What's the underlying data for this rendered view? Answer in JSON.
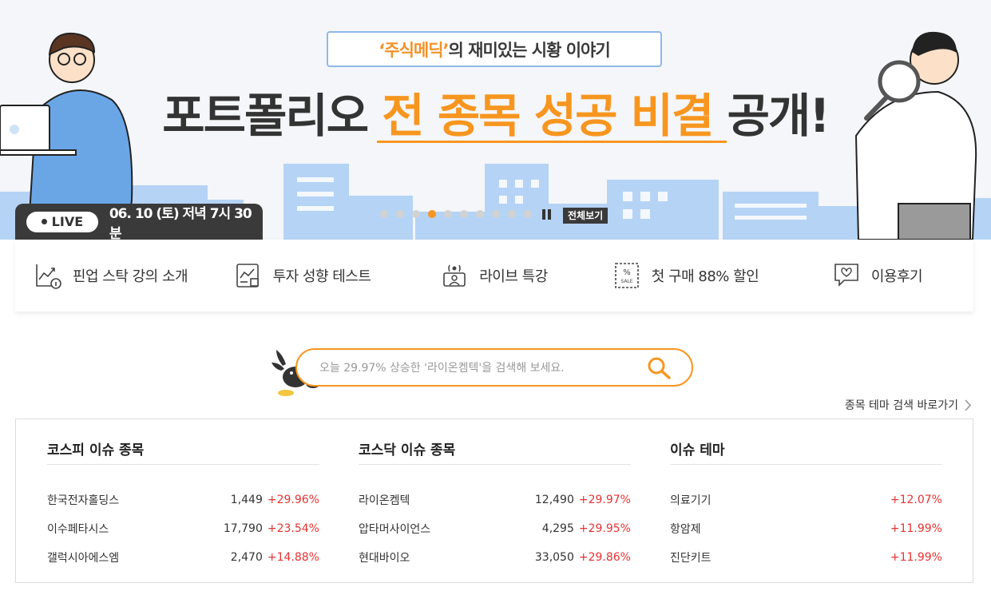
{
  "banner": {
    "subtitle_highlight": "‘주식메딕’",
    "subtitle_rest": "의 재미있는 시황 이야기",
    "headline_pre": "포트폴리오",
    "headline_highlight": "전 종목 성공 비결",
    "headline_post": "공개!",
    "live_label": "LIVE",
    "live_datetime": "06. 10 (토) 저녁 7시 30분",
    "slide_count": 10,
    "active_slide": 4,
    "view_all_label": "전체보기",
    "accent_color": "#f7961f"
  },
  "menu": [
    {
      "label": "핀업 스탁 강의 소개",
      "icon": "chart-info-icon"
    },
    {
      "label": "투자 성향 테스트",
      "icon": "test-chart-icon"
    },
    {
      "label": "라이브 특강",
      "icon": "live-broadcast-icon"
    },
    {
      "label": "첫 구매 88% 할인",
      "icon": "sale-tag-icon"
    },
    {
      "label": "이용후기",
      "icon": "review-chat-icon"
    }
  ],
  "search": {
    "placeholder": "오늘 29.97% 상승한 '라이온켐텍'을 검색해 보세요."
  },
  "theme_link": "종목 테마 검색 바로가기",
  "panels": {
    "kospi": {
      "title": "코스피 이슈 종목",
      "rows": [
        {
          "name": "한국전자홀딩스",
          "price": "1,449",
          "change": "+29.96%"
        },
        {
          "name": "이수페타시스",
          "price": "17,790",
          "change": "+23.54%"
        },
        {
          "name": "갤럭시아에스엠",
          "price": "2,470",
          "change": "+14.88%"
        }
      ]
    },
    "kosdaq": {
      "title": "코스닥 이슈 종목",
      "rows": [
        {
          "name": "라이온켐텍",
          "price": "12,490",
          "change": "+29.97%"
        },
        {
          "name": "압타머사이언스",
          "price": "4,295",
          "change": "+29.95%"
        },
        {
          "name": "현대바이오",
          "price": "33,050",
          "change": "+29.86%"
        }
      ]
    },
    "theme": {
      "title": "이슈 테마",
      "rows": [
        {
          "name": "의료기기",
          "change": "+12.07%"
        },
        {
          "name": "항암제",
          "change": "+11.99%"
        },
        {
          "name": "진단키트",
          "change": "+11.99%"
        }
      ]
    }
  }
}
